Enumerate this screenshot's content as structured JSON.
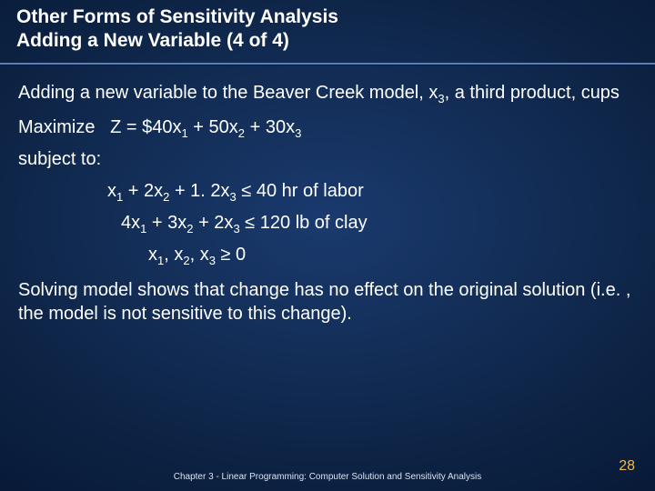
{
  "header": {
    "line1": "Other Forms of Sensitivity Analysis",
    "line2": "Adding a New Variable (4 of 4)"
  },
  "body": {
    "intro_html": "Adding a new variable to the Beaver Creek model, x<sub>3</sub>, a third product, cups",
    "objective_html": "Maximize &nbsp;&nbsp;Z = $40x<sub>1</sub> + 50x<sub>2</sub> + 30x<sub>3</sub>",
    "subject_to": "subject to:",
    "constraints": {
      "c1_html": "x<sub>1</sub> + 2x<sub>2</sub> + 1. 2x<sub>3</sub> ≤ 40 hr of labor",
      "c2_html": "4x<sub>1</sub> + 3x<sub>2</sub> + 2x<sub>3</sub> ≤ 120 lb of clay",
      "c3_html": "x<sub>1</sub>, x<sub>2</sub>, x<sub>3</sub> ≥ 0"
    },
    "conclusion": "Solving model shows that change has no effect on the original solution (i.e. , the model is not sensitive to this change)."
  },
  "footer": {
    "chapter": "Chapter 3 - Linear Programming:  Computer Solution and Sensitivity Analysis",
    "page": "28"
  }
}
